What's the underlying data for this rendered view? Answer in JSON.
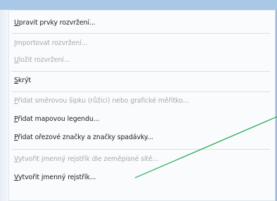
{
  "menu": {
    "items": [
      {
        "mn": "U",
        "rest": "pravit prvky rozvržení...",
        "disabled": false
      },
      {
        "mn": "I",
        "rest": "mportovat rozvržení...",
        "disabled": true
      },
      {
        "mn": "U",
        "rest": "ložit rozvržení...",
        "disabled": true
      },
      {
        "mn": "S",
        "rest": "krýt",
        "disabled": false
      },
      {
        "mn": "P",
        "rest": "řidat směrovou šipku (růžici) nebo grafické měřítko...",
        "disabled": true
      },
      {
        "mn": "P",
        "rest": "řidat mapovou legendu...",
        "disabled": false
      },
      {
        "mn": "P",
        "rest": "řidat ořezové značky a značky spadávky...",
        "disabled": false
      },
      {
        "mn": "V",
        "rest": "ytvořit jmenný rejstřík dle zeměpisné sítě...",
        "disabled": true
      },
      {
        "mn": "V",
        "rest": "ytvořit jmenný rejstřík...",
        "disabled": false
      }
    ]
  },
  "colors": {
    "background": "#a9c7e6",
    "menu_bg": "#fafbfd",
    "leader_line": "#1aa84a"
  }
}
